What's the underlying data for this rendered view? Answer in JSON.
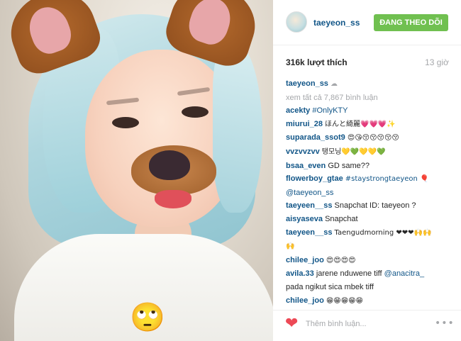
{
  "post": {
    "username": "taeyeon_ss",
    "follow_label": "ĐANG THEO DÕI",
    "likes": "316k lượt thích",
    "time": "13 giờ"
  },
  "photo": {
    "sticker_emoji": "🙄"
  },
  "caption": {
    "user": "taeyeon_ss",
    "text": "☁"
  },
  "view_all": "xem tất cả 7,867 bình luận",
  "comments": [
    {
      "user": "acekty",
      "text": "#OnlyKTY"
    },
    {
      "user": "miurui_28",
      "text": "ほんと綺麗💗💗💗✨"
    },
    {
      "user": "suparada_ssot9",
      "text": "😍😘😚😚😚😚😚"
    },
    {
      "user": "vvzvvzvv",
      "text": "탱모닝💛💚💛💛💚"
    },
    {
      "user": "bsaa_even",
      "text": "GD same??"
    },
    {
      "user": "flowerboy_gtae",
      "text": "#staystrongtaeyeon 🎈",
      "mention": "@taeyeon_ss"
    },
    {
      "user": "taeyeen__ss",
      "text": "Snapchat ID: taeyeon ?"
    },
    {
      "user": "aisyaseva",
      "text": "Snapchat"
    },
    {
      "user": "taeyeen__ss",
      "text": "Taengudmorning ❤❤❤🙌🙌",
      "text2": "🙌"
    },
    {
      "user": "chilee_joo",
      "text": "😍😍😍😍"
    },
    {
      "user": "avila.33",
      "text": "jarene nduwene tiff",
      "mention": "@anacitra_",
      "text2": "pada ngikut sica mbek tiff"
    },
    {
      "user": "chilee_joo",
      "text": "😁😁😁😁😁"
    }
  ],
  "footer": {
    "heart_icon": "❤",
    "placeholder": "Thêm bình luận...",
    "more_icon": "•••"
  },
  "colors": {
    "username": "#125688",
    "follow_button": "#70c050",
    "muted": "#a5a7aa",
    "heart": "#ed4956"
  }
}
